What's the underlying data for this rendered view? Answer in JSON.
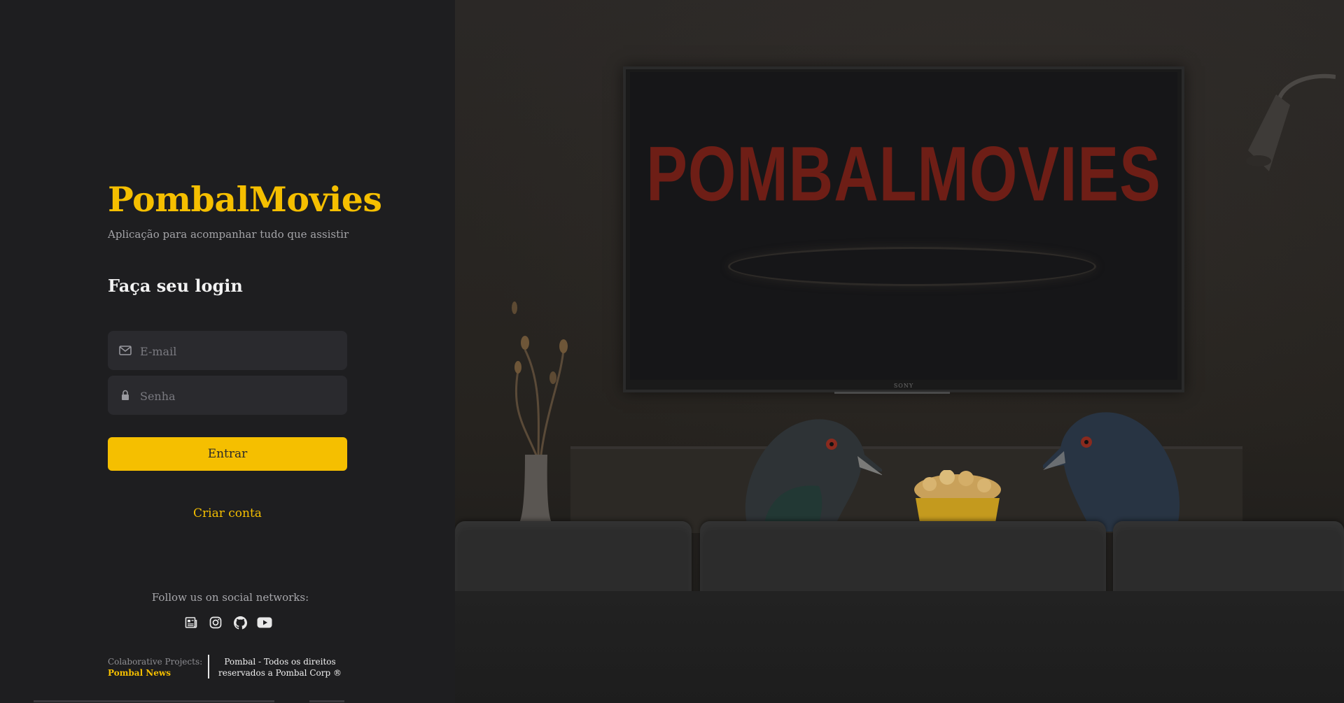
{
  "app": {
    "title": "PombalMovies",
    "tagline": "Aplicação para acompanhar tudo que assistir"
  },
  "login": {
    "heading": "Faça seu login",
    "email_placeholder": "E-mail",
    "password_placeholder": "Senha",
    "submit_label": "Entrar",
    "create_account_label": "Criar conta"
  },
  "social": {
    "heading": "Follow us on social networks:",
    "icons": [
      "news-icon",
      "instagram-icon",
      "github-icon",
      "youtube-icon"
    ]
  },
  "footer": {
    "collab_label": "Colaborative Projects:",
    "collab_link": "Pombal News",
    "rights_line1": "Pombal - Todos os direitos",
    "rights_line2": "reservados a Pombal Corp ®"
  },
  "hero": {
    "tv_logo": "POMBALMOVIES",
    "tv_brand": "SONY"
  },
  "colors": {
    "accent": "#f5bf00",
    "panel": "#1e1e20",
    "input_bg": "#2a2a2e"
  }
}
